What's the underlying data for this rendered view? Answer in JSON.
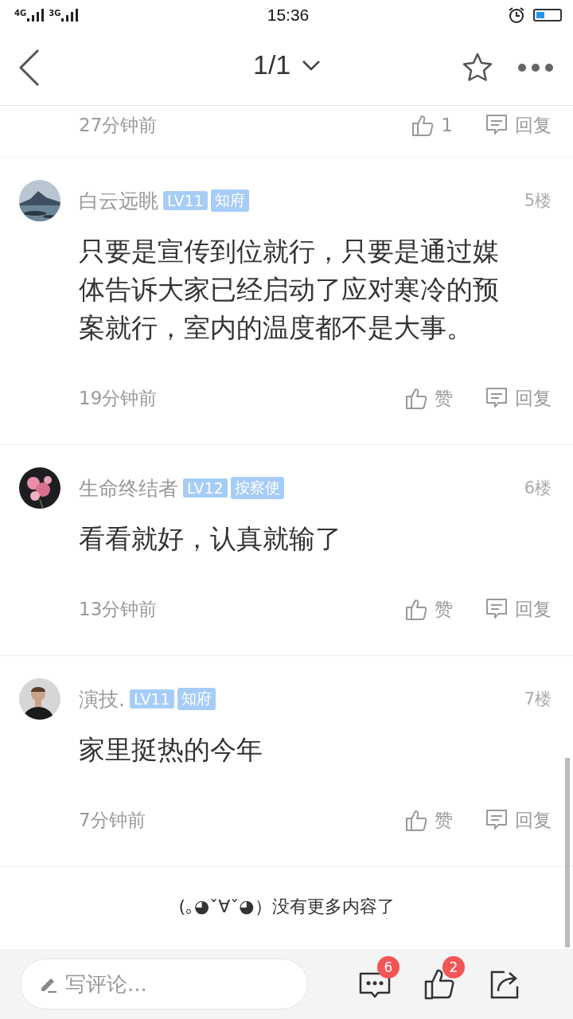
{
  "status_bar": {
    "network_1": "4G",
    "network_2": "3G",
    "time": "15:36"
  },
  "nav_bar": {
    "title": "1/1"
  },
  "previous_comment": {
    "time": "27分钟前",
    "likes": "1",
    "reply": "回复"
  },
  "comments": [
    {
      "user": "白云远眺",
      "level": "LV11",
      "title": "知府",
      "floor": "5楼",
      "text": "只要是宣传到位就行，只要是通过媒体告诉大家已经启动了应对寒冷的预案就行，室内的温度都不是大事。",
      "time": "19分钟前",
      "like": "赞",
      "reply": "回复"
    },
    {
      "user": "生命终结者",
      "level": "LV12",
      "title": "按察使",
      "floor": "6楼",
      "text": "看看就好，认真就输了",
      "time": "13分钟前",
      "like": "赞",
      "reply": "回复"
    },
    {
      "user": "演技.",
      "level": "LV11",
      "title": "知府",
      "floor": "7楼",
      "text": "家里挺热的今年",
      "time": "7分钟前",
      "like": "赞",
      "reply": "回复"
    }
  ],
  "end_message": "(｡◕ˇ∀ˇ◕）没有更多内容了",
  "bottom_bar": {
    "placeholder": "写评论...",
    "comment_count": "6",
    "like_count": "2"
  }
}
